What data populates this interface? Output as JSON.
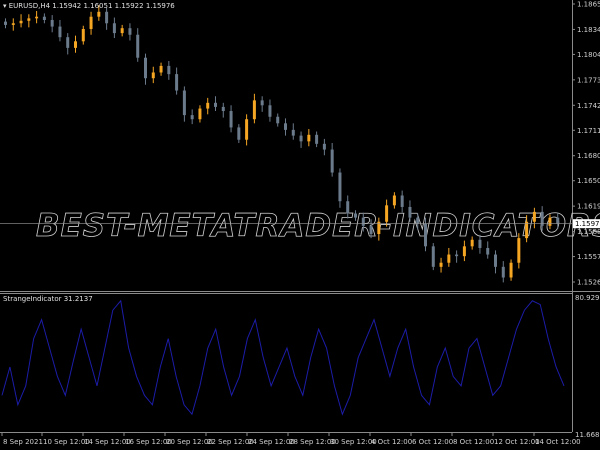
{
  "header": {
    "symbol": "EURUSD,H4",
    "ohlc": "1.15942 1.16051 1.15922 1.15976"
  },
  "indicator_header": {
    "name": "StrangeIndicator",
    "value": "31.2137"
  },
  "watermark": "BEST-METATRADER-INDICATORS.COM",
  "colors": {
    "bull": "#f5a623",
    "bear": "#6b7b8c",
    "indicator": "#1c1ca8",
    "grid": "#7a7a7a",
    "background": "#000000"
  },
  "chart_data": [
    {
      "type": "candlestick",
      "symbol": "EURUSD",
      "timeframe": "H4",
      "ylim": [
        1.152,
        1.187
      ],
      "y_ticks": [
        "1.18655",
        "1.18345",
        "1.18040",
        "1.17730",
        "1.17420",
        "1.17115",
        "1.16805",
        "1.16500",
        "1.16190",
        "1.15880",
        "1.15575",
        "1.15265"
      ],
      "current_price": "1.15976",
      "x_ticks": [
        "8 Sep 2021",
        "10 Sep 12:00",
        "14 Sep 12:00",
        "16 Sep 12:00",
        "20 Sep 12:00",
        "22 Sep 12:00",
        "24 Sep 12:00",
        "28 Sep 12:00",
        "30 Sep 12:00",
        "4 Oct 12:00",
        "6 Oct 12:00",
        "8 Oct 12:00",
        "12 Oct 12:00",
        "14 Oct 12:00"
      ],
      "closes": [
        1.184,
        1.1842,
        1.1845,
        1.1848,
        1.185,
        1.1846,
        1.1838,
        1.1825,
        1.1812,
        1.182,
        1.1835,
        1.185,
        1.1856,
        1.1842,
        1.183,
        1.1836,
        1.1828,
        1.18,
        1.1775,
        1.1782,
        1.179,
        1.178,
        1.176,
        1.173,
        1.1725,
        1.1738,
        1.1745,
        1.174,
        1.1735,
        1.1715,
        1.17,
        1.1725,
        1.1748,
        1.1742,
        1.1728,
        1.172,
        1.1712,
        1.1705,
        1.1698,
        1.1706,
        1.1695,
        1.1688,
        1.166,
        1.1625,
        1.161,
        1.1605,
        1.1595,
        1.1585,
        1.16,
        1.162,
        1.1632,
        1.1618,
        1.1605,
        1.1598,
        1.157,
        1.1545,
        1.155,
        1.156,
        1.1558,
        1.157,
        1.1578,
        1.1568,
        1.156,
        1.1545,
        1.1532,
        1.155,
        1.158,
        1.16,
        1.1612,
        1.1595,
        1.1605,
        1.1598
      ]
    },
    {
      "type": "line",
      "title": "StrangeIndicator",
      "ylim": [
        11.6689,
        80.9291
      ],
      "y_ticks": [
        "80.9291",
        "11.6689"
      ],
      "values": [
        30,
        45,
        25,
        35,
        60,
        70,
        55,
        40,
        30,
        48,
        65,
        50,
        35,
        55,
        75,
        80,
        55,
        40,
        30,
        25,
        45,
        60,
        40,
        25,
        20,
        35,
        55,
        65,
        45,
        30,
        40,
        60,
        70,
        50,
        35,
        45,
        55,
        40,
        30,
        50,
        65,
        55,
        35,
        20,
        30,
        50,
        60,
        70,
        55,
        40,
        55,
        65,
        45,
        30,
        25,
        45,
        55,
        40,
        35,
        55,
        60,
        45,
        30,
        35,
        50,
        65,
        75,
        80,
        78,
        60,
        45,
        35
      ]
    }
  ]
}
